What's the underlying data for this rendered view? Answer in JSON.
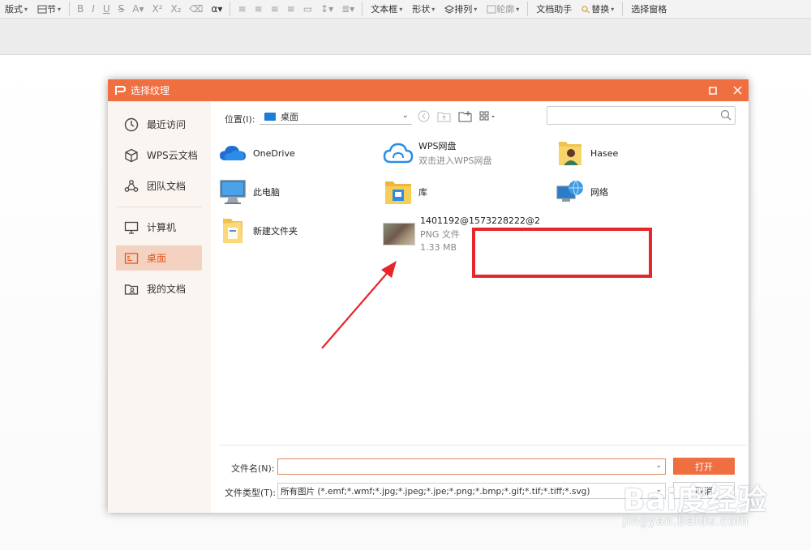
{
  "toolbar": {
    "items": [
      {
        "label": "版式"
      },
      {
        "label": "节"
      },
      {
        "label": "文本框"
      },
      {
        "label": "形状"
      },
      {
        "label": "排列"
      },
      {
        "label": "轮廓"
      },
      {
        "label": "文档助手"
      },
      {
        "label": "替换"
      },
      {
        "label": "选择窗格"
      }
    ]
  },
  "dialog": {
    "title": "选择纹理",
    "sidebar": [
      {
        "label": "最近访问",
        "icon": "clock-icon"
      },
      {
        "label": "WPS云文档",
        "icon": "cube-icon"
      },
      {
        "label": "团队文档",
        "icon": "team-icon"
      },
      {
        "label": "计算机",
        "icon": "monitor-icon"
      },
      {
        "label": "桌面",
        "icon": "desktop-icon",
        "active": true
      },
      {
        "label": "我的文档",
        "icon": "user-folder-icon"
      }
    ],
    "location": {
      "label": "位置(I):",
      "value": "桌面"
    },
    "search": {
      "placeholder": ""
    },
    "files": [
      {
        "name": "OneDrive",
        "sub": "",
        "icon": "onedrive-icon"
      },
      {
        "name": "WPS网盘",
        "sub": "双击进入WPS网盘",
        "icon": "wps-cloud-icon"
      },
      {
        "name": "Hasee",
        "sub": "",
        "icon": "user-folder-icon"
      },
      {
        "name": "此电脑",
        "sub": "",
        "icon": "computer-icon"
      },
      {
        "name": "库",
        "sub": "",
        "icon": "library-icon"
      },
      {
        "name": "网络",
        "sub": "",
        "icon": "network-icon"
      },
      {
        "name": "新建文件夹",
        "sub": "",
        "icon": "folder-icon"
      },
      {
        "name": "1401192@1573228222@2",
        "sub": "PNG 文件",
        "size": "1.33 MB",
        "icon": "image-thumbnail"
      }
    ],
    "footer": {
      "filename_label": "文件名(N):",
      "filename_value": "",
      "filetype_label": "文件类型(T):",
      "filetype_value": "所有图片 (*.emf;*.wmf;*.jpg;*.jpeg;*.jpe;*.png;*.bmp;*.gif;*.tif;*.tiff;*.svg)",
      "open_label": "打开",
      "cancel_label": "取消"
    }
  },
  "watermark": {
    "main": "Bai度经验",
    "sub": "jingyan.baidu.com"
  },
  "colors": {
    "accent": "#f06f41",
    "highlight": "#e8252a",
    "sidebar_active_bg": "#f4d2c2"
  }
}
